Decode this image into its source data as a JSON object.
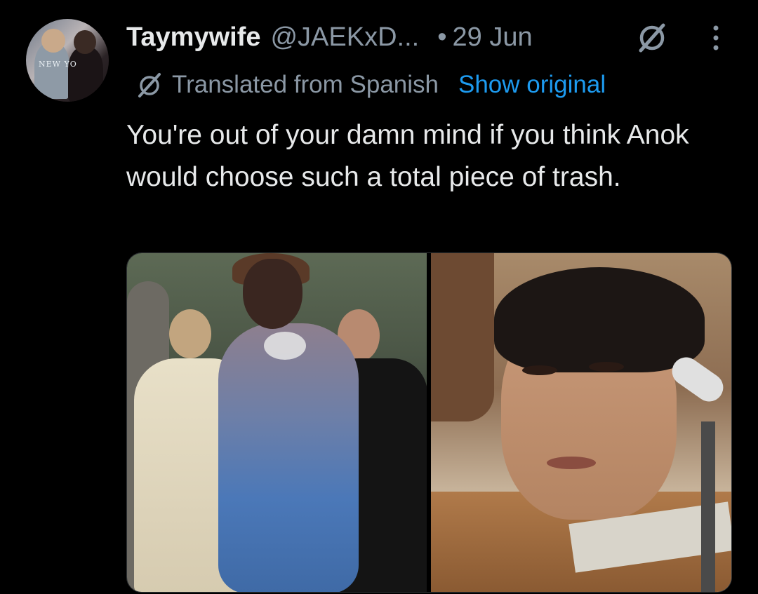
{
  "tweet": {
    "display_name": "Taymywife",
    "handle": "@JAEKxD...",
    "separator": "•",
    "date": "29 Jun",
    "translation": {
      "label": "Translated from Spanish",
      "show_original": "Show original"
    },
    "text": "You're out of your damn mind if you think Anok would choose such a total piece of trash.",
    "avatar_shirt_text": "NEW YO"
  },
  "colors": {
    "background": "#000000",
    "primary_text": "#e7e9ea",
    "secondary_text": "#8b98a5",
    "link": "#1d9bf0"
  },
  "icons": {
    "grok": "grok-icon",
    "more": "more-dots-icon",
    "translate": "translate-icon"
  }
}
